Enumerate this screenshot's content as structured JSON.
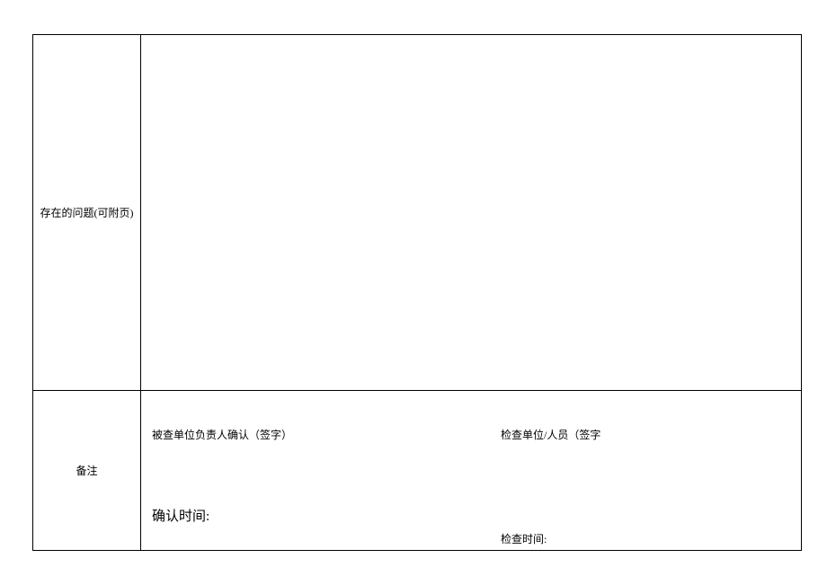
{
  "rows": {
    "problems": {
      "label": "存在的问题(可附页)"
    },
    "remarks": {
      "label": "备注",
      "sig_left": "被查单位负责人确认（签字）",
      "sig_right": "检查单位/人员（签字",
      "confirm_time": "确认时间:",
      "inspect_time": "检查时间:"
    }
  }
}
